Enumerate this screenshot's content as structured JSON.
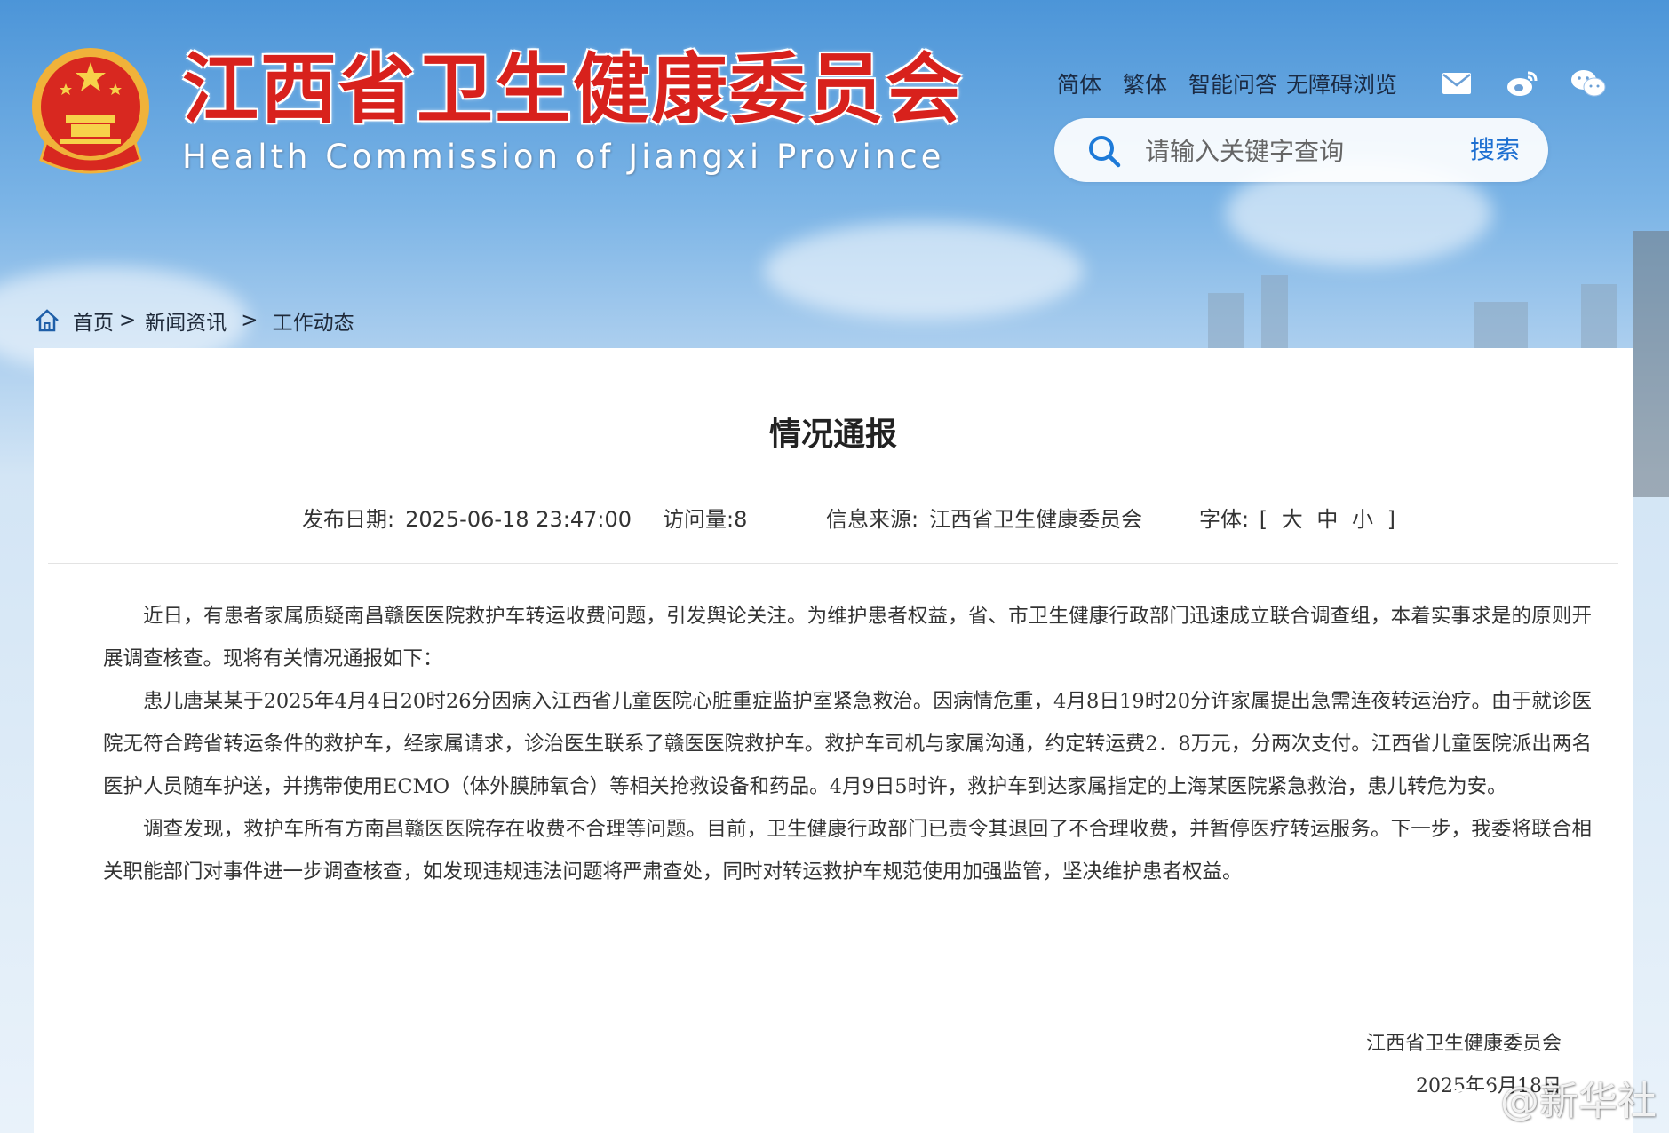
{
  "header": {
    "title": "江西省卫生健康委员会",
    "subtitle": "Health Commission of Jiangxi Province",
    "links": [
      "简体",
      "繁体",
      "智能问答",
      "无障碍浏览"
    ],
    "search": {
      "placeholder": "请输入关键字查询",
      "button": "搜索"
    }
  },
  "breadcrumb": {
    "items": [
      "首页",
      "新闻资讯",
      "工作动态"
    ],
    "separator": ">"
  },
  "article": {
    "title": "情况通报",
    "meta": {
      "date_label": "发布日期:",
      "date": "2025-06-18 23:47:00",
      "visits": "访问量:8",
      "source_label": "信息来源:",
      "source": "江西省卫生健康委员会",
      "font_label": "字体:",
      "font_open": "[",
      "font_options": [
        "大",
        "中",
        "小"
      ],
      "font_close": "]"
    },
    "paragraphs": [
      "近日，有患者家属质疑南昌赣医医院救护车转运收费问题，引发舆论关注。为维护患者权益，省、市卫生健康行政部门迅速成立联合调查组，本着实事求是的原则开展调查核查。现将有关情况通报如下：",
      "患儿唐某某于2025年4月4日20时26分因病入江西省儿童医院心脏重症监护室紧急救治。因病情危重，4月8日19时20分许家属提出急需连夜转运治疗。由于就诊医院无符合跨省转运条件的救护车，经家属请求，诊治医生联系了赣医医院救护车。救护车司机与家属沟通，约定转运费2．8万元，分两次支付。江西省儿童医院派出两名医护人员随车护送，并携带使用ECMO（体外膜肺氧合）等相关抢救设备和药品。4月9日5时许，救护车到达家属指定的上海某医院紧急救治，患儿转危为安。",
      "调查发现，救护车所有方南昌赣医医院存在收费不合理等问题。目前，卫生健康行政部门已责令其退回了不合理收费，并暂停医疗转运服务。下一步，我委将联合相关职能部门对事件进一步调查核查，如发现违规违法问题将严肃查处，同时对转运救护车规范使用加强监管，坚决维护患者权益。"
    ],
    "signature": "江西省卫生健康委员会",
    "sign_date": "2025年6月18日"
  },
  "watermark": "@新华社",
  "colors": {
    "title_red": "#d8211c",
    "link_blue": "#1d6fd1"
  }
}
